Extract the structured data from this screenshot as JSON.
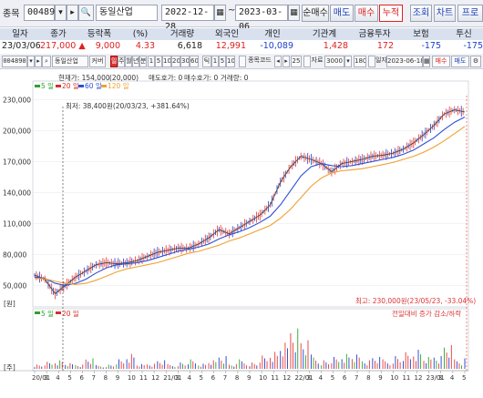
{
  "toolbar1": {
    "code_label": "종목",
    "code": "004890",
    "name": "동일산업",
    "date_from": "2022-12-28",
    "date_to": "2023-03-06",
    "mode_tabs": [
      "순매수",
      "매도",
      "매수",
      "누적"
    ],
    "active_mode": "누적",
    "actions": [
      "조회",
      "차트",
      "프로그램"
    ]
  },
  "table": {
    "headers": [
      "일자",
      "종가",
      "등락폭",
      "(%)",
      "거래량",
      "외국인",
      "개인",
      "기관계",
      "금융투자",
      "보험",
      "투신"
    ],
    "row": {
      "date": "23/03/06",
      "close": "217,000",
      "arrow": "▲",
      "change": "9,000",
      "pct": "4.33",
      "volume": "6,618",
      "foreign": "12,991",
      "individual": "-10,089",
      "institution": "1,428",
      "fin_invest": "172",
      "insurance": "-175",
      "trust": "-175"
    }
  },
  "chart_toolbar": {
    "code": "004890",
    "name": "동일산업",
    "type": "커버",
    "period_buttons": [
      "일",
      "주",
      "월",
      "년",
      "분",
      "1",
      "5",
      "10",
      "20",
      "30",
      "60",
      "틱",
      "1",
      "5",
      "10"
    ],
    "active_period": "일",
    "stock_code_label": "종목코드",
    "count": "25",
    "display_label": "자료",
    "display_count": "3000",
    "unit": "180",
    "date_label": "일자",
    "date": "2023-06-18",
    "right_buttons": [
      "매수",
      "매도"
    ]
  },
  "price_panel": {
    "info_line": [
      "현재가: 154,000",
      "(20,000)",
      "매도호가: 0",
      "매수호가: 0",
      "거래량: 0"
    ],
    "legend": [
      {
        "label": "5 일",
        "color": "#2aa52a"
      },
      {
        "label": "20 일",
        "color": "#d32f2f"
      },
      {
        "label": "60 일",
        "color": "#2c4fd6"
      },
      {
        "label": "120 일",
        "color": "#f0a030"
      }
    ],
    "low_label": "최저: 38,400원(20/03/23, +381.64%)",
    "high_label": "최고: 230,000원(23/05/23, -33.04%)",
    "y_ticks": [
      "230,000",
      "200,000",
      "170,000",
      "140,000",
      "110,000",
      "80,000",
      "50,000"
    ],
    "unit_label": "[원]"
  },
  "volume_panel": {
    "legend": [
      {
        "label": "5 일",
        "color": "#2aa52a"
      },
      {
        "label": "20 일",
        "color": "#d32f2f"
      }
    ],
    "right_label": "전일대비 증가 감소/하락",
    "unit_label": "[주]"
  },
  "x_ticks": [
    "20/01",
    "3",
    "4",
    "5",
    "6",
    "7",
    "8",
    "9",
    "10",
    "11",
    "12",
    "21/01",
    "3",
    "4",
    "5",
    "6",
    "7",
    "8",
    "9",
    "10",
    "11",
    "12",
    "22/01",
    "3",
    "4",
    "5",
    "6",
    "7",
    "8",
    "9",
    "10",
    "11",
    "12",
    "23/01",
    "3",
    "4",
    "5"
  ],
  "chart_data": {
    "type": "line",
    "title": "",
    "xlabel": "",
    "ylabel": "원",
    "ylim": [
      38000,
      232000
    ],
    "y_ticks": [
      50000,
      80000,
      110000,
      140000,
      170000,
      200000,
      230000
    ],
    "x_range": [
      "2020-01",
      "2023-06"
    ],
    "series": [
      {
        "name": "종가",
        "color": "#444444",
        "values": [
          60000,
          56000,
          42000,
          50000,
          58000,
          64000,
          70000,
          72000,
          71000,
          72000,
          74000,
          78000,
          82000,
          84000,
          86000,
          86000,
          90000,
          96000,
          104000,
          100000,
          106000,
          112000,
          118000,
          128000,
          150000,
          165000,
          175000,
          172000,
          168000,
          160000,
          168000,
          170000,
          172000,
          175000,
          176000,
          178000,
          182000,
          188000,
          196000,
          205000,
          216000,
          220000,
          218000
        ]
      },
      {
        "name": "60 일",
        "color": "#2c4fd6",
        "values": [
          58000,
          57000,
          52000,
          50000,
          52000,
          56000,
          62000,
          67000,
          70000,
          71000,
          72000,
          74000,
          77000,
          80000,
          83000,
          85000,
          87000,
          90000,
          95000,
          99000,
          102000,
          106000,
          111000,
          117000,
          128000,
          142000,
          156000,
          165000,
          168000,
          166000,
          165000,
          166000,
          168000,
          170000,
          172000,
          174000,
          177000,
          181000,
          187000,
          193000,
          201000,
          208000,
          213000
        ]
      },
      {
        "name": "120 일",
        "color": "#f0a030",
        "values": [
          57000,
          56500,
          54000,
          52000,
          51000,
          52000,
          55000,
          59000,
          63000,
          66000,
          68000,
          70000,
          72000,
          75000,
          78000,
          81000,
          83000,
          86000,
          89000,
          93000,
          96000,
          100000,
          104000,
          108000,
          115000,
          124000,
          135000,
          146000,
          154000,
          159000,
          161000,
          162000,
          163000,
          165000,
          167000,
          169000,
          172000,
          175000,
          179000,
          184000,
          190000,
          197000,
          204000
        ]
      }
    ],
    "volume_rel": [
      0.1,
      0.15,
      0.2,
      0.12,
      0.1,
      0.22,
      0.08,
      0.1,
      0.2,
      0.35,
      0.1,
      0.12,
      0.18,
      0.1,
      0.15,
      0.2,
      0.12,
      0.18,
      0.3,
      0.1,
      0.2,
      0.15,
      0.28,
      0.4,
      0.55,
      0.95,
      0.6,
      0.3,
      0.2,
      0.25,
      0.35,
      0.3,
      0.2,
      0.25,
      0.2,
      0.3,
      0.35,
      0.45,
      0.25,
      0.3,
      0.5,
      0.2,
      0.6
    ]
  }
}
